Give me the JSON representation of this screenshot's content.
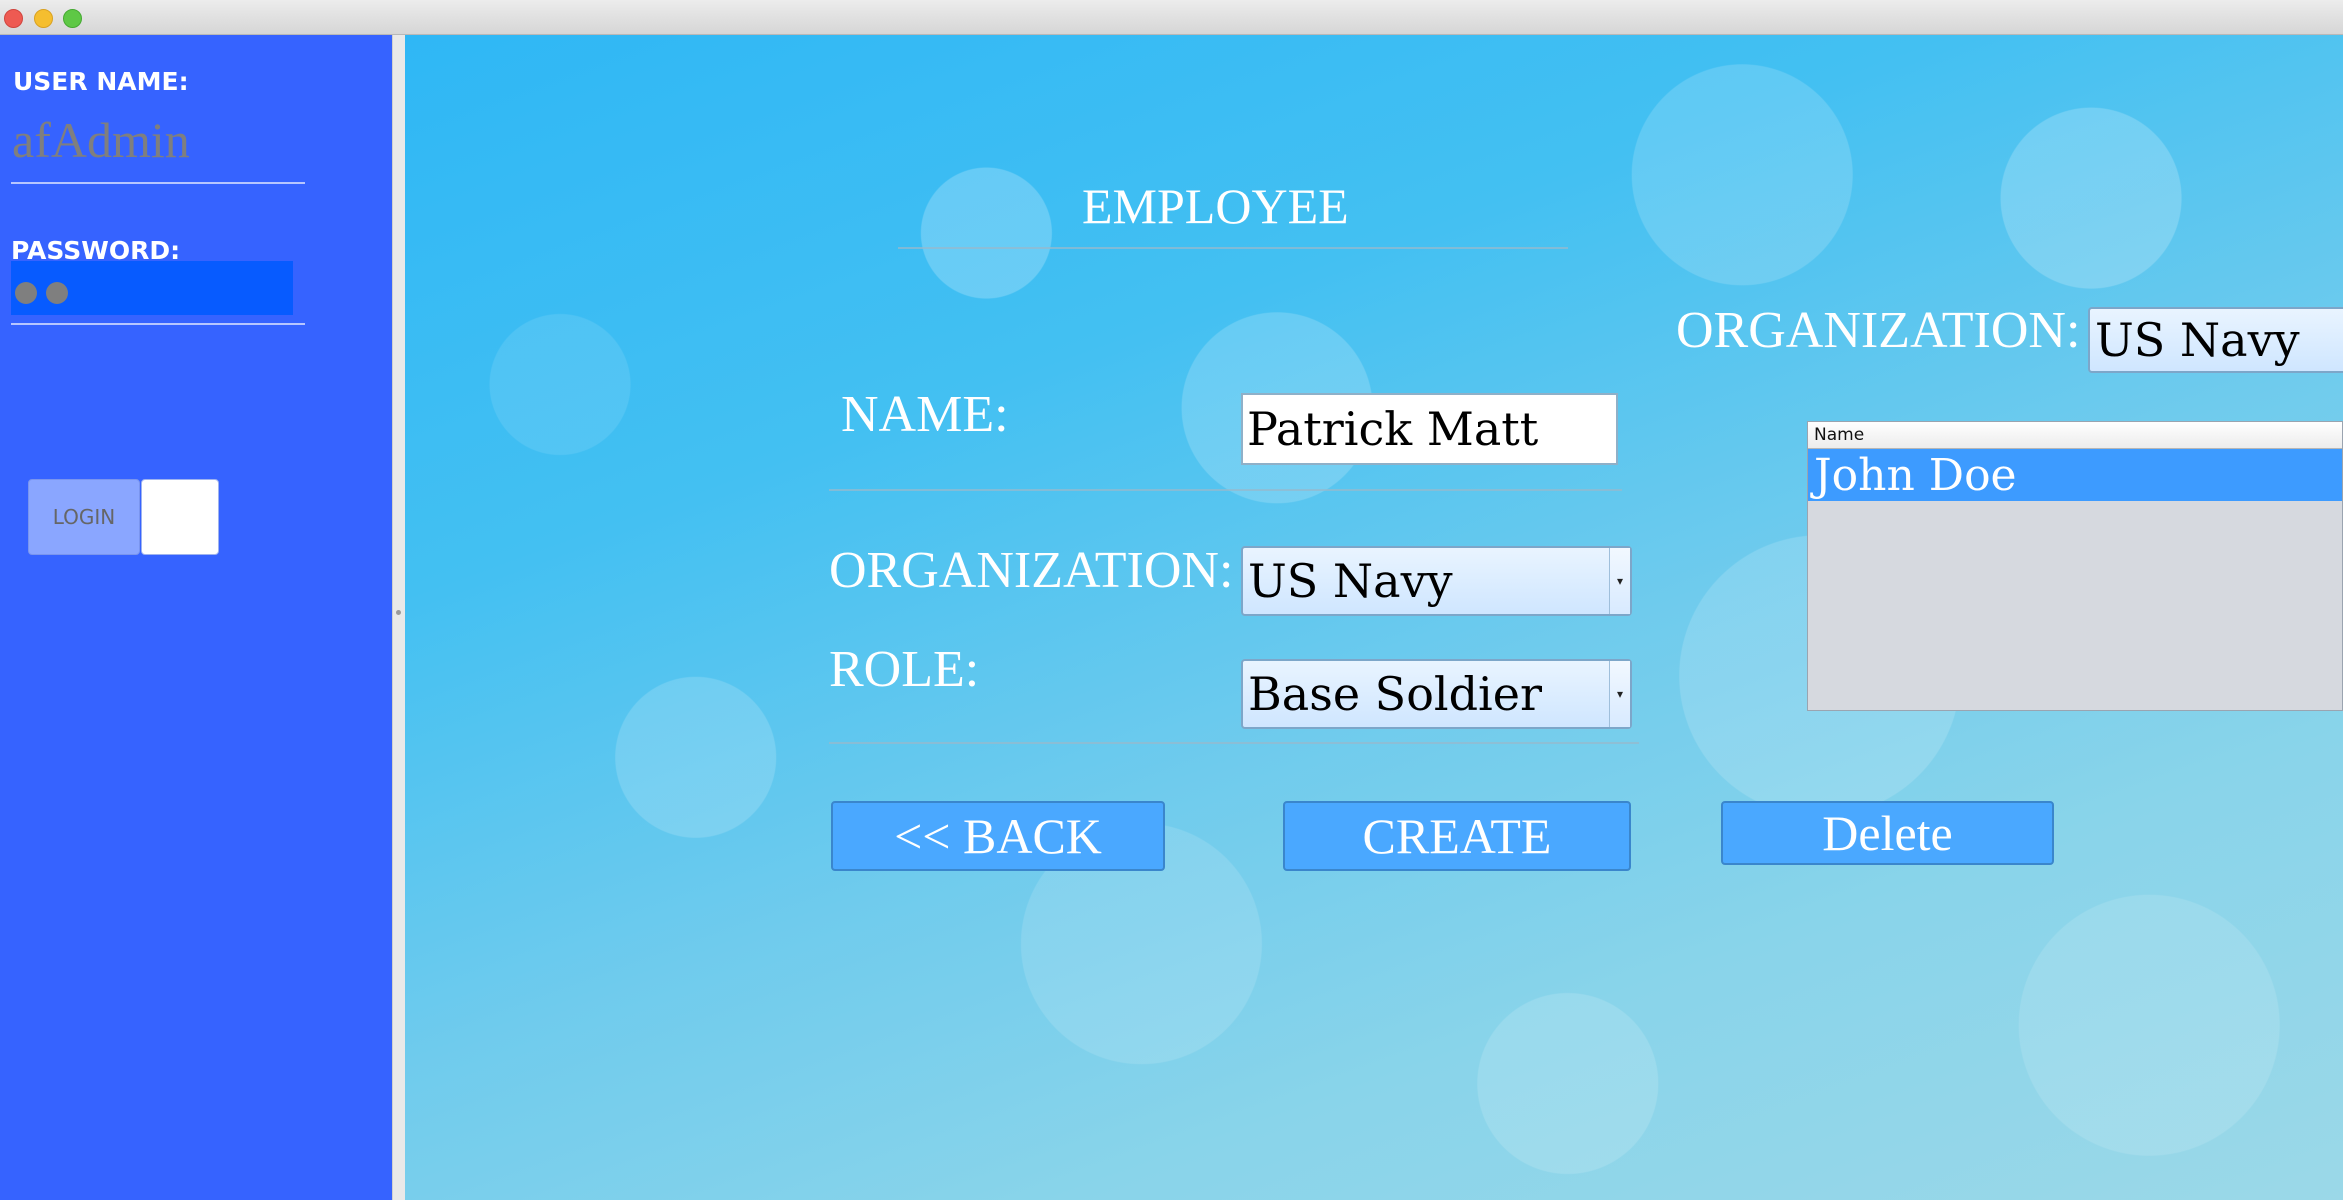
{
  "sidebar": {
    "username_label": "USER NAME:",
    "username_value": "afAdmin",
    "password_label": "PASSWORD:",
    "login_label": "LOGIN"
  },
  "form": {
    "title": "EMPLOYEE",
    "name_label": "NAME:",
    "name_value": "Patrick Matt",
    "organization_label": "ORGANIZATION:",
    "organization_value": "US Navy",
    "role_label": "ROLE:",
    "role_value": "Base Soldier"
  },
  "filter": {
    "organization_label": "ORGANIZATION:",
    "organization_value": "US Navy"
  },
  "table": {
    "header": "Name",
    "rows": [
      "John Doe"
    ]
  },
  "buttons": {
    "back": "<< BACK",
    "create": "CREATE",
    "delete": "Delete"
  },
  "colors": {
    "sidebar": "#3663ff",
    "button": "#4aa8ff",
    "selection": "#3d9bff"
  }
}
